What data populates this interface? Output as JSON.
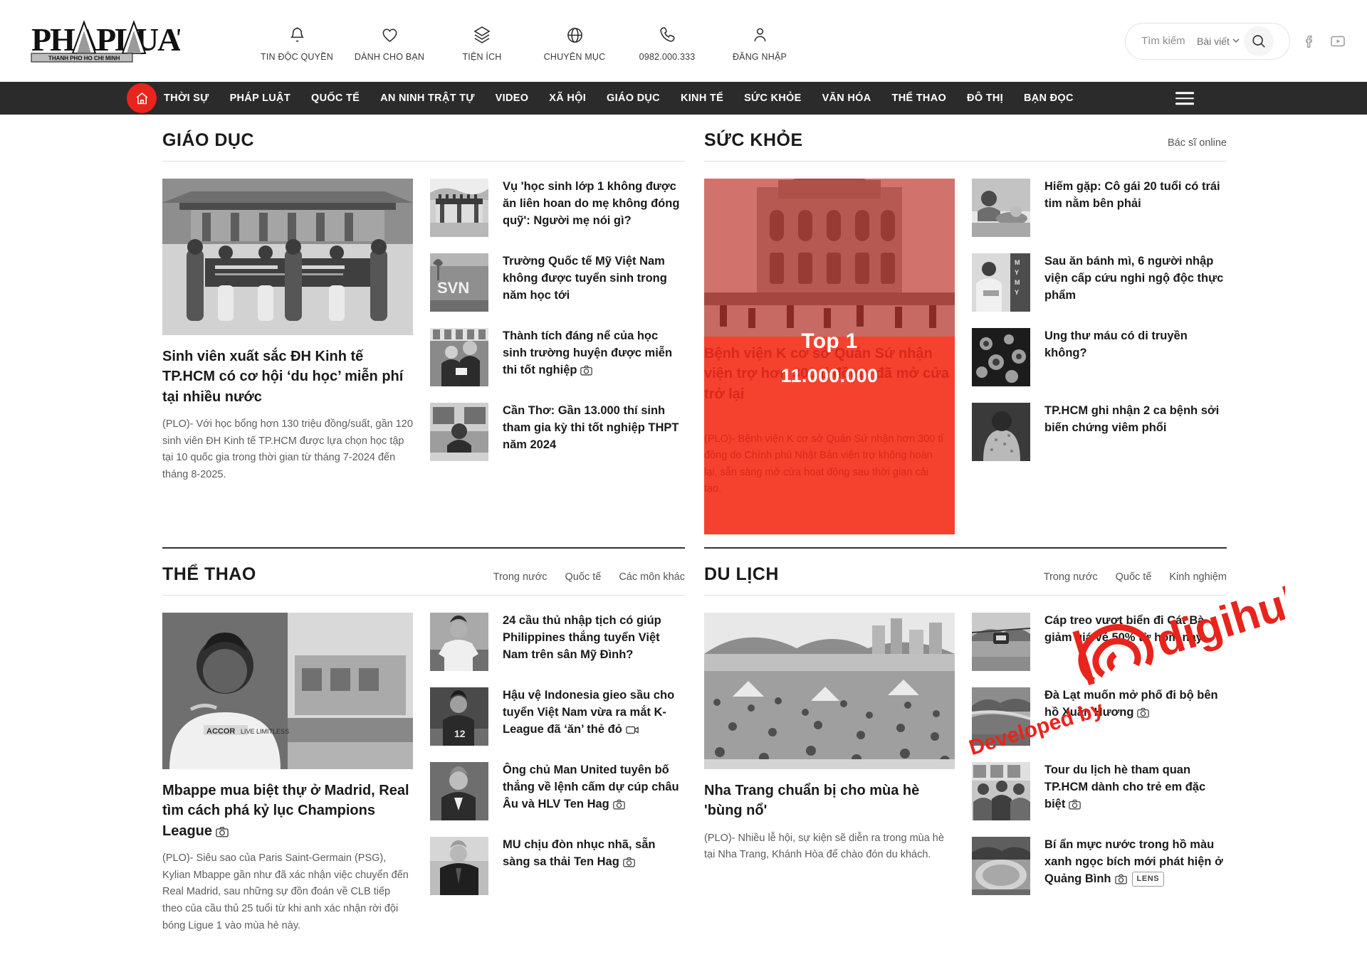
{
  "brand": {
    "logo_main": "PHAPLUAT",
    "logo_sub": "THANH PHO HO CHI MINH"
  },
  "header": {
    "items": [
      {
        "icon": "bell-icon",
        "label": "TIN ĐỘC QUYỀN"
      },
      {
        "icon": "heart-icon",
        "label": "DÀNH CHO BẠN"
      },
      {
        "icon": "layers-icon",
        "label": "TIỆN ÍCH"
      },
      {
        "icon": "globe-icon",
        "label": "CHUYÊN MỤC"
      },
      {
        "icon": "phone-icon",
        "label": "0982.000.333"
      },
      {
        "icon": "user-icon",
        "label": "ĐĂNG NHẬP"
      }
    ],
    "search": {
      "placeholder": "Tìm kiếm",
      "value": "",
      "filter_label": "Bài viết",
      "search_icon": "search-icon"
    },
    "social": [
      {
        "icon": "facebook-icon",
        "label": "Facebook"
      },
      {
        "icon": "youtube-icon",
        "label": "YouTube"
      }
    ]
  },
  "mainnav": {
    "home_icon": "home-icon",
    "menu_icon": "hamburger-icon",
    "items": [
      "THỜI SỰ",
      "PHÁP LUẬT",
      "QUỐC TẾ",
      "AN NINH TRẬT TỰ",
      "VIDEO",
      "XÃ HỘI",
      "GIÁO DỤC",
      "KINH TẾ",
      "SỨC KHỎE",
      "VĂN HÓA",
      "THỂ THAO",
      "ĐÔ THỊ",
      "BẠN ĐỌC"
    ]
  },
  "sections": {
    "giaoduc": {
      "title": "GIÁO DỤC",
      "feature": {
        "title": "Sinh viên xuất sắc ĐH Kinh tế TP.HCM có cơ hội ‘du học’ miễn phí tại nhiều nước",
        "sapo": "(PLO)- Với học bổng hơn 130 triệu đồng/suất, gần 120 sinh viên ĐH Kinh tế TP.HCM được lựa chọn học tập tại 10 quốc gia trong thời gian từ tháng 7-2024 đến tháng 8-2025."
      },
      "list": [
        {
          "title": "Vụ 'học sinh lớp 1 không được ăn liên hoan do mẹ không đóng quỹ': Người mẹ nói gì?",
          "badge": ""
        },
        {
          "title": "Trường Quốc tế Mỹ Việt Nam không được tuyển sinh trong năm học tới",
          "badge": ""
        },
        {
          "title": "Thành tích đáng nể của học sinh trường huyện được miễn thi tốt nghiệp",
          "badge": "camera-icon"
        },
        {
          "title": "Cần Thơ: Gần 13.000 thí sinh tham gia kỳ thi tốt nghiệp THPT năm 2024",
          "badge": ""
        }
      ]
    },
    "suckhoe": {
      "title": "SỨC KHỎE",
      "link_label": "Bác sĩ online",
      "feature": {
        "title": "Bệnh viện K cơ sở Quán Sứ nhận viện trợ hơn 300 tỉ đồng, đã mở cửa trở lại",
        "sapo": "(PLO)- Bệnh viện K cơ sở Quán Sứ nhận hơn 300 tỉ đồng do Chính phủ Nhật Bản viện trợ không hoàn lại, sẵn sàng mở cửa hoạt động sau thời gian cải tạo.",
        "overlay_label": "Top 1",
        "overlay_value": "11.000.000"
      },
      "list": [
        {
          "title": "Hiếm gặp: Cô gái 20 tuổi có trái tim nằm bên phải",
          "badge": ""
        },
        {
          "title": "Sau ăn bánh mì, 6 người nhập viện cấp cứu nghi ngộ độc thực phẩm",
          "badge": ""
        },
        {
          "title": "Ung thư máu có di truyền không?",
          "badge": ""
        },
        {
          "title": "TP.HCM ghi nhận 2 ca bệnh sởi biến chứng viêm phổi",
          "badge": ""
        }
      ]
    },
    "thethao": {
      "title": "THỂ THAO",
      "tabs": [
        "Trong nước",
        "Quốc tế",
        "Các môn khác"
      ],
      "feature": {
        "title": "Mbappe mua biệt thự ở Madrid, Real tìm cách phá kỷ lục Champions League",
        "badge": "camera-icon",
        "sapo": "(PLO)- Siêu sao của Paris Saint-Germain (PSG), Kylian Mbappe gần như đã xác nhận việc chuyển đến Real Madrid, sau những sự đồn đoán về CLB tiếp theo của cầu thủ 25 tuổi từ khi anh xác nhận rời đội bóng Ligue 1 vào mùa hè này."
      },
      "list": [
        {
          "title": "24 cầu thủ nhập tịch có giúp Philippines thắng tuyển Việt Nam trên sân Mỹ Đình?",
          "badge": ""
        },
        {
          "title": "Hậu vệ Indonesia gieo sầu cho tuyển Việt Nam vừa ra mắt K-League đã ‘ăn’ thẻ đỏ",
          "badge": "video-icon"
        },
        {
          "title": "Ông chủ Man United tuyên bố thắng về lệnh cấm dự cúp châu Âu và HLV Ten Hag",
          "badge": "camera-icon"
        },
        {
          "title": "MU chịu đòn nhục nhã, sẵn sàng sa thải Ten Hag",
          "badge": "camera-icon"
        }
      ]
    },
    "dulich": {
      "title": "DU LỊCH",
      "tabs": [
        "Trong nước",
        "Quốc tế",
        "Kinh nghiệm"
      ],
      "feature": {
        "title": "Nha Trang chuẩn bị cho mùa hè 'bùng nổ'",
        "sapo": "(PLO)- Nhiều lễ hội, sự kiện sẽ diễn ra trong mùa hè tại Nha Trang, Khánh Hòa để chào đón du khách."
      },
      "list": [
        {
          "title": "Cáp treo vượt biển đi Cát Bà giảm giá vé 50% từ hôm nay",
          "badge": ""
        },
        {
          "title": "Đà Lạt muốn mở phố đi bộ bên hồ Xuân Hương",
          "badge": "camera-icon"
        },
        {
          "title": "Tour du lịch hè tham quan TP.HCM dành cho trẻ em đặc biệt",
          "badge": "camera-icon"
        },
        {
          "title": "Bí ẩn mực nước trong hồ màu xanh ngọc bích mới phát hiện ở Quảng Bình",
          "badge": "camera-icon",
          "extra_badge": "LENS"
        }
      ]
    }
  },
  "watermark": {
    "text": "Developed by",
    "brand": "digihub",
    "color": "#e8241c"
  },
  "colors": {
    "accent": "#e8241c",
    "promo_bg": "#f4422e",
    "nav_bg": "#2b2b2b"
  }
}
